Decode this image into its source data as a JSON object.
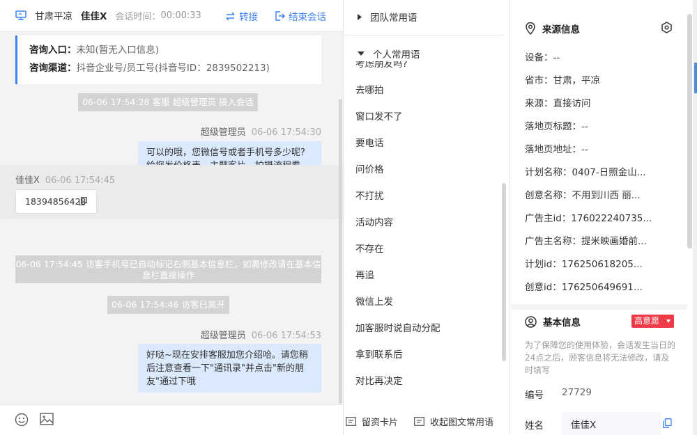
{
  "header": {
    "location": "甘肃平凉",
    "visitor_name": "佳佳X",
    "session_time_label": "会话时间：",
    "session_time": "00:00:33",
    "transfer_label": "转接",
    "end_label": "结束会话"
  },
  "info_card": {
    "entry_label": "咨询入口：",
    "entry_value": "未知(暂无入口信息)",
    "channel_label": "咨询渠道：",
    "channel_value": "抖音企业号/员工号(抖音号ID：2839502213)"
  },
  "messages": {
    "sys1": "06-06 17:54:28 客服 超级管理员 接入会话",
    "agent1_name": "超级管理员",
    "agent1_time": "06-06 17:54:30",
    "agent1_text": "可以的哦，您微信号或者手机号多少呢?给您发价格表、主题客片、拍摄流程看下，您可以对比了解一下哈",
    "visitor_name": "佳佳X",
    "visitor_time": "06-06 17:54:45",
    "visitor_text": "18394856428",
    "sys2": "06-06 17:54:45 访客手机号已自动标记右侧基本信息栏，如需修改请在基本信息栏直接操作",
    "sys3": "06-06 17:54:46 访客已离开",
    "agent2_name": "超级管理员",
    "agent2_time": "06-06 17:54:53",
    "agent2_text": "好哒~现在安排客服加您介绍哈。请您稍后注意查看一下\"通讯录\"并点击\"新的朋友\"通过下哦"
  },
  "phrases": {
    "team_group": "团队常用语",
    "personal_group": "个人常用语",
    "partial_item": "考虑朋友吗?",
    "items": [
      "去哪拍",
      "窗口发不了",
      "要电话",
      "问价格",
      "不打扰",
      "活动内容",
      "不存在",
      "再追",
      "微信上发",
      "加客服时说自动分配",
      "拿到联系后",
      "对比再决定"
    ],
    "card_button": "留资卡片",
    "collect_button": "收起图文常用语"
  },
  "source_info": {
    "title": "来源信息",
    "device_label": "设备：",
    "device_value": "--",
    "province_label": "省市：",
    "province_value": "甘肃，平凉",
    "source_label": "来源：",
    "source_value": "直接访问",
    "landing_title_label": "落地页标题：",
    "landing_title_value": "--",
    "landing_url_label": "落地页地址：",
    "landing_url_value": "--",
    "plan_name_label": "计划名称：",
    "plan_name_value": "0407-日照金山...",
    "creative_name_label": "创意名称：",
    "creative_name_value": "不用到川西 丽...",
    "advertiser_id_label": "广告主id：",
    "advertiser_id_value": "176022240735...",
    "advertiser_name_label": "广告主名称：",
    "advertiser_name_value": "提米映画婚前...",
    "plan_id_label": "计划id：",
    "plan_id_value": "176250618205...",
    "creative_id_label": "创意id：",
    "creative_id_value": "176250649691..."
  },
  "basic_info": {
    "title": "基本信息",
    "intent_badge": "高意愿",
    "note": "为了保障您的使用体验，会话发生当日的24点之后，顾客信息将无法修改，请及时填写",
    "number_label": "编号",
    "number_value": "27729",
    "name_label": "姓名",
    "name_value": "佳佳X"
  },
  "colors": {
    "accent": "#3b82f6",
    "bubble_out": "#dbe9fd",
    "system_msg": "#d3d3d3",
    "badge": "#ee3b48"
  }
}
